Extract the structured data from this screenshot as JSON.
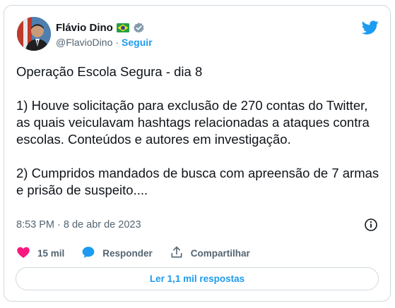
{
  "author": {
    "name": "Flávio Dino",
    "handle": "@FlavioDino",
    "separator": "·",
    "follow_label": "Seguir"
  },
  "tweet": {
    "text": "Operação Escola Segura - dia 8\n\n1) Houve solicitação para exclusão de 270 contas do Twitter, as quais veiculavam hashtags relacionadas a ataques contra escolas. Conteúdos e autores em investigação.\n\n2) Cumpridos mandados de busca com apreensão de 7 armas e prisão de suspeito....",
    "timestamp": "8:53 PM · 8 de abr de 2023"
  },
  "actions": {
    "like_count": "15 mil",
    "reply_label": "Responder",
    "share_label": "Compartilhar"
  },
  "read_replies_label": "Ler 1,1 mil respostas",
  "icons": {
    "brand": "twitter-bird-icon",
    "verified": "verified-badge-icon",
    "flag": "brazil-flag-icon",
    "like": "heart-icon",
    "reply": "reply-bubble-icon",
    "share": "share-icon",
    "info": "info-icon"
  },
  "colors": {
    "accent": "#1d9bf0",
    "like": "#f91880",
    "muted": "#536471",
    "border": "#cfd9de",
    "verified_gray": "#829aab"
  }
}
